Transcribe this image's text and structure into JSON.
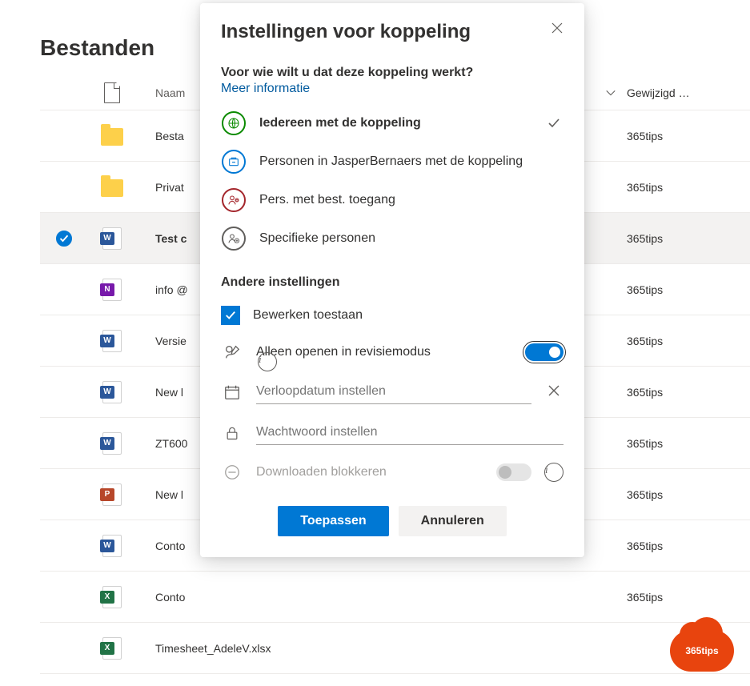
{
  "page": {
    "title": "Bestanden"
  },
  "columns": {
    "name_header": "Naam",
    "modified_by_header": "Gewijzigd …"
  },
  "files": [
    {
      "name": "Besta",
      "type": "folder",
      "modified_by": "365tips",
      "selected": false
    },
    {
      "name": "Privat",
      "type": "folder",
      "modified_by": "365tips",
      "selected": false
    },
    {
      "name": "Test c",
      "type": "word",
      "modified_by": "365tips",
      "selected": true
    },
    {
      "name": "info @",
      "type": "onenote",
      "modified_by": "365tips",
      "selected": false
    },
    {
      "name": "Versie",
      "type": "word",
      "modified_by": "365tips",
      "selected": false
    },
    {
      "name": "New l",
      "type": "word",
      "modified_by": "365tips",
      "selected": false
    },
    {
      "name": "ZT600",
      "type": "word",
      "modified_by": "365tips",
      "selected": false
    },
    {
      "name": "New l",
      "type": "ppt",
      "modified_by": "365tips",
      "selected": false
    },
    {
      "name": "Conto",
      "type": "word",
      "modified_by": "365tips",
      "selected": false
    },
    {
      "name": "Conto",
      "type": "excel",
      "modified_by": "365tips",
      "selected": false
    },
    {
      "name": "Timesheet_AdeleV.xlsx",
      "type": "excel",
      "modified_by": "",
      "selected": false
    }
  ],
  "modal": {
    "title": "Instellingen voor koppeling",
    "subtitle": "Voor wie wilt u dat deze koppeling werkt?",
    "learn_more": "Meer informatie",
    "options": [
      {
        "label": "Iedereen met de koppeling",
        "selected": true,
        "color": "green"
      },
      {
        "label": "Personen in JasperBernaers met de koppeling",
        "selected": false,
        "color": "blue"
      },
      {
        "label": "Pers. met best. toegang",
        "selected": false,
        "color": "red"
      },
      {
        "label": "Specifieke personen",
        "selected": false,
        "color": "grey"
      }
    ],
    "other_settings_title": "Andere instellingen",
    "allow_editing": {
      "label": "Bewerken toestaan",
      "checked": true
    },
    "review_mode": {
      "label": "Alleen openen in revisiemodus",
      "on": true
    },
    "expiration": {
      "placeholder": "Verloopdatum instellen"
    },
    "password": {
      "placeholder": "Wachtwoord instellen"
    },
    "block_download": {
      "label": "Downloaden blokkeren",
      "on": false
    },
    "apply_button": "Toepassen",
    "cancel_button": "Annuleren"
  },
  "brand": {
    "label": "365tips"
  }
}
